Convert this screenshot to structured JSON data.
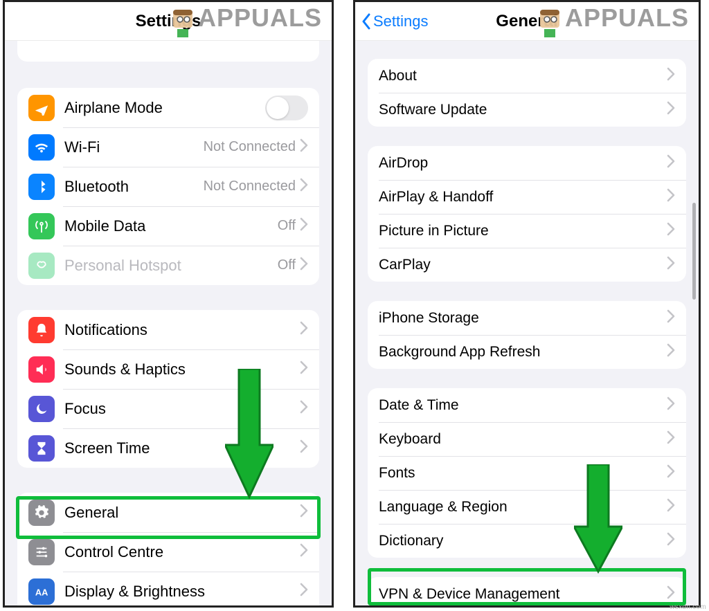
{
  "left": {
    "header": {
      "title": "Settings"
    },
    "group_conn": [
      {
        "id": "airplane",
        "label": "Airplane Mode",
        "value": "",
        "toggle": true,
        "dim": false,
        "iconColor": "orange",
        "iconSvg": "plane"
      },
      {
        "id": "wifi",
        "label": "Wi-Fi",
        "value": "Not Connected",
        "toggle": false,
        "dim": false,
        "iconColor": "blue",
        "iconSvg": "wifi"
      },
      {
        "id": "bluetooth",
        "label": "Bluetooth",
        "value": "Not Connected",
        "toggle": false,
        "dim": false,
        "iconColor": "blue2",
        "iconSvg": "bluetooth"
      },
      {
        "id": "mobile",
        "label": "Mobile Data",
        "value": "Off",
        "toggle": false,
        "dim": false,
        "iconColor": "green",
        "iconSvg": "antenna"
      },
      {
        "id": "hotspot",
        "label": "Personal Hotspot",
        "value": "Off",
        "toggle": false,
        "dim": true,
        "iconColor": "lightgreen",
        "iconSvg": "link"
      }
    ],
    "group_notif": [
      {
        "id": "notifications",
        "label": "Notifications",
        "iconColor": "red",
        "iconSvg": "bell"
      },
      {
        "id": "sounds",
        "label": "Sounds & Haptics",
        "iconColor": "pink",
        "iconSvg": "speaker"
      },
      {
        "id": "focus",
        "label": "Focus",
        "iconColor": "indigo",
        "iconSvg": "moon"
      },
      {
        "id": "screentime",
        "label": "Screen Time",
        "iconColor": "indigo",
        "iconSvg": "hourglass"
      }
    ],
    "group_sys": [
      {
        "id": "general",
        "label": "General",
        "iconColor": "grey",
        "iconSvg": "gear",
        "highlight": true
      },
      {
        "id": "control",
        "label": "Control Centre",
        "iconColor": "grey",
        "iconSvg": "sliders"
      },
      {
        "id": "display",
        "label": "Display & Brightness",
        "iconColor": "bluebox",
        "iconSvg": "textsize"
      }
    ]
  },
  "right": {
    "header": {
      "back": "Settings",
      "title": "General"
    },
    "g1": [
      {
        "id": "about",
        "label": "About"
      },
      {
        "id": "swupd",
        "label": "Software Update"
      }
    ],
    "g2": [
      {
        "id": "airdrop",
        "label": "AirDrop"
      },
      {
        "id": "airplay",
        "label": "AirPlay & Handoff"
      },
      {
        "id": "pip",
        "label": "Picture in Picture"
      },
      {
        "id": "carplay",
        "label": "CarPlay"
      }
    ],
    "g3": [
      {
        "id": "storage",
        "label": "iPhone Storage"
      },
      {
        "id": "bgapp",
        "label": "Background App Refresh"
      }
    ],
    "g4": [
      {
        "id": "datetime",
        "label": "Date & Time"
      },
      {
        "id": "keyboard",
        "label": "Keyboard"
      },
      {
        "id": "fonts",
        "label": "Fonts"
      },
      {
        "id": "lang",
        "label": "Language & Region"
      },
      {
        "id": "dict",
        "label": "Dictionary"
      }
    ],
    "g5": [
      {
        "id": "vpn",
        "label": "VPN & Device Management",
        "highlight": true
      }
    ]
  },
  "watermark": "APPUALS",
  "footer": "wsxdn.com"
}
